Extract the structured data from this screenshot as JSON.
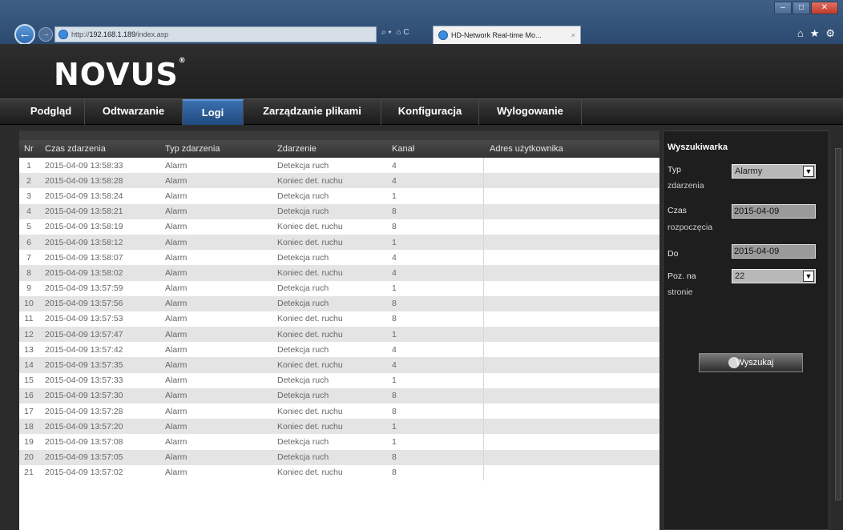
{
  "browser": {
    "url_prefix": "http://",
    "url_host": "192.168.1.189",
    "url_path": "/index.asp",
    "address_tools": [
      "⌕ ▾",
      "⌂ C"
    ],
    "tab_title": "HD-Network Real-time Mo...",
    "tab_close": "×"
  },
  "logo": {
    "text": "NOVUS",
    "mark": "®"
  },
  "menu": [
    {
      "label": "Podgląd",
      "active": false
    },
    {
      "label": "Odtwarzanie",
      "active": false
    },
    {
      "label": "Logi",
      "active": true
    },
    {
      "label": "Zarządzanie plikami",
      "active": false
    },
    {
      "label": "Konfiguracja",
      "active": false
    },
    {
      "label": "Wylogowanie",
      "active": false
    }
  ],
  "table": {
    "headers": [
      "Nr",
      "Czas zdarzenia",
      "Typ zdarzenia",
      "Zdarzenie",
      "Kanał",
      "Adres użytkownika"
    ],
    "rows": [
      [
        "1",
        "2015-04-09 13:58:33",
        "Alarm",
        "Detekcja ruch",
        "4",
        ""
      ],
      [
        "2",
        "2015-04-09 13:58:28",
        "Alarm",
        "Koniec det. ruchu",
        "4",
        ""
      ],
      [
        "3",
        "2015-04-09 13:58:24",
        "Alarm",
        "Detekcja ruch",
        "1",
        ""
      ],
      [
        "4",
        "2015-04-09 13:58:21",
        "Alarm",
        "Detekcja ruch",
        "8",
        ""
      ],
      [
        "5",
        "2015-04-09 13:58:19",
        "Alarm",
        "Koniec det. ruchu",
        "8",
        ""
      ],
      [
        "6",
        "2015-04-09 13:58:12",
        "Alarm",
        "Koniec det. ruchu",
        "1",
        ""
      ],
      [
        "7",
        "2015-04-09 13:58:07",
        "Alarm",
        "Detekcja ruch",
        "4",
        ""
      ],
      [
        "8",
        "2015-04-09 13:58:02",
        "Alarm",
        "Koniec det. ruchu",
        "4",
        ""
      ],
      [
        "9",
        "2015-04-09 13:57:59",
        "Alarm",
        "Detekcja ruch",
        "1",
        ""
      ],
      [
        "10",
        "2015-04-09 13:57:56",
        "Alarm",
        "Detekcja ruch",
        "8",
        ""
      ],
      [
        "11",
        "2015-04-09 13:57:53",
        "Alarm",
        "Koniec det. ruchu",
        "8",
        ""
      ],
      [
        "12",
        "2015-04-09 13:57:47",
        "Alarm",
        "Koniec det. ruchu",
        "1",
        ""
      ],
      [
        "13",
        "2015-04-09 13:57:42",
        "Alarm",
        "Detekcja ruch",
        "4",
        ""
      ],
      [
        "14",
        "2015-04-09 13:57:35",
        "Alarm",
        "Koniec det. ruchu",
        "4",
        ""
      ],
      [
        "15",
        "2015-04-09 13:57:33",
        "Alarm",
        "Detekcja ruch",
        "1",
        ""
      ],
      [
        "16",
        "2015-04-09 13:57:30",
        "Alarm",
        "Detekcja ruch",
        "8",
        ""
      ],
      [
        "17",
        "2015-04-09 13:57:28",
        "Alarm",
        "Koniec det. ruchu",
        "8",
        ""
      ],
      [
        "18",
        "2015-04-09 13:57:20",
        "Alarm",
        "Koniec det. ruchu",
        "1",
        ""
      ],
      [
        "19",
        "2015-04-09 13:57:08",
        "Alarm",
        "Detekcja ruch",
        "1",
        ""
      ],
      [
        "20",
        "2015-04-09 13:57:05",
        "Alarm",
        "Detekcja ruch",
        "8",
        ""
      ],
      [
        "21",
        "2015-04-09 13:57:02",
        "Alarm",
        "Koniec det. ruchu",
        "8",
        ""
      ]
    ]
  },
  "search": {
    "title": "Wyszukiwarka",
    "type_label_1": "Typ",
    "type_label_2": "zdarzenia",
    "type_value": "Alarmy",
    "start_label_1": "Czas",
    "start_label_2": "rozpoczęcia",
    "start_value": "2015-04-09",
    "end_label": "Do",
    "end_value": "2015-04-09",
    "per_page_label_1": "Poz. na",
    "per_page_label_2": "stronie",
    "per_page_value": "22",
    "button_label": "Wyszukaj"
  },
  "icons": {
    "back": "back-arrow-icon",
    "forward": "forward-arrow-icon",
    "home": "home-icon",
    "favorites": "star-icon",
    "settings": "gear-icon",
    "dropdown": "chevron-down-icon",
    "search": "magnifier-icon"
  }
}
